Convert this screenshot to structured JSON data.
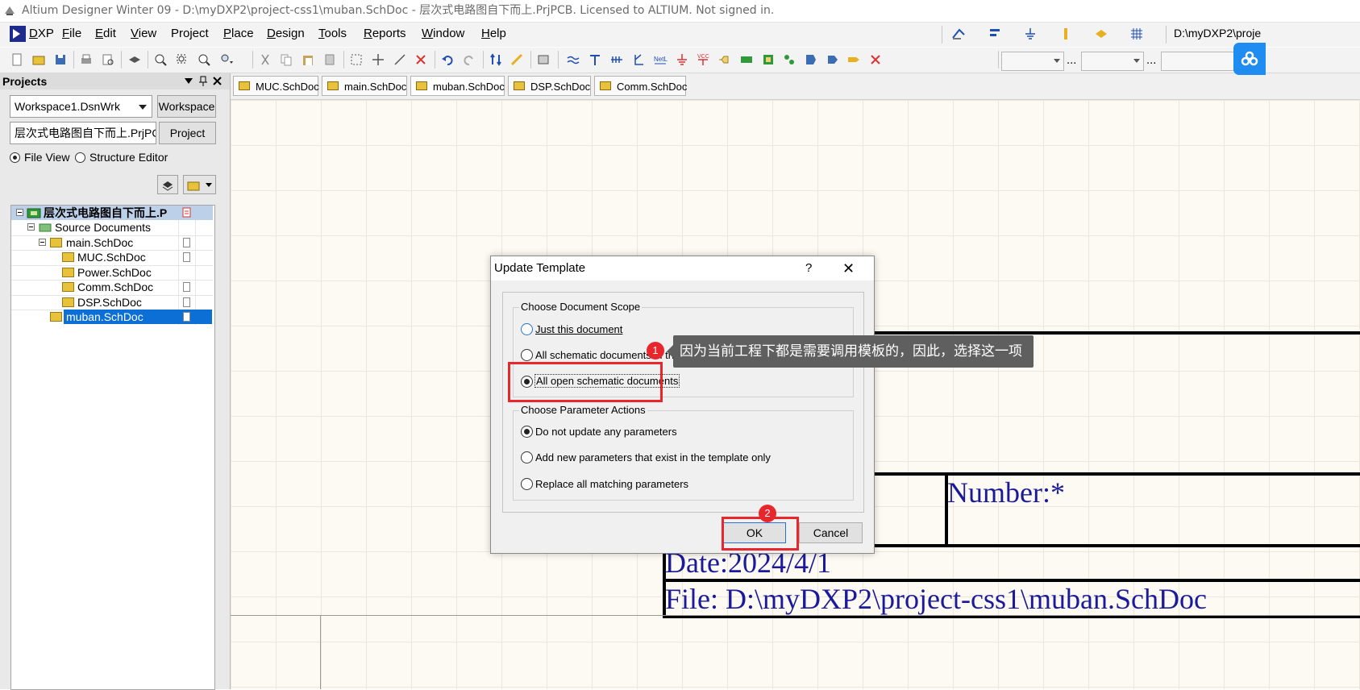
{
  "window": {
    "title": "Altium Designer Winter 09 - D:\\myDXP2\\project-css1\\muban.SchDoc - 层次式电路图自下而上.PrjPCB. Licensed to ALTIUM. Not signed in."
  },
  "menu": {
    "items": [
      {
        "first": "D",
        "rest": "XP"
      },
      {
        "first": "F",
        "rest": "ile"
      },
      {
        "first": "E",
        "rest": "dit"
      },
      {
        "first": "V",
        "rest": "iew"
      },
      {
        "first": "",
        "rest": "Project"
      },
      {
        "first": "P",
        "rest": "lace"
      },
      {
        "first": "D",
        "rest": "esign"
      },
      {
        "first": "T",
        "rest": "ools"
      },
      {
        "first": "R",
        "rest": "eports"
      },
      {
        "first": "W",
        "rest": "indow"
      },
      {
        "first": "H",
        "rest": "elp"
      }
    ],
    "path_text": "D:\\myDXP2\\proje"
  },
  "toolbar": {
    "combo_dots": "..."
  },
  "projects_panel": {
    "title": "Projects",
    "workspace_combo": "Workspace1.DsnWrk",
    "workspace_button": "Workspace",
    "project_combo": "层次式电路图自下而上.PrjPC",
    "project_button": "Project",
    "file_view_label": "File View",
    "structure_editor_label": "Structure Editor",
    "tree": {
      "root": "层次式电路图自下而上.P",
      "source_documents": "Source Documents",
      "main": "main.SchDoc",
      "muc": "MUC.SchDoc",
      "power": "Power.SchDoc",
      "comm": "Comm.SchDoc",
      "dsp": "DSP.SchDoc",
      "muban": "muban.SchDoc"
    }
  },
  "doc_tabs": [
    "MUC.SchDoc",
    "main.SchDoc",
    "muban.SchDoc",
    "DSP.SchDoc",
    "Comm.SchDoc"
  ],
  "sheet": {
    "number_label": "Number:*",
    "date_label": "Date:2024/4/1",
    "file_label": "File:  D:\\myDXP2\\project-css1\\muban.SchDoc"
  },
  "dialog": {
    "title": "Update Template",
    "help": "?",
    "close": "✕",
    "scope_group": "Choose Document Scope",
    "opt_just_this": "Just this document",
    "opt_all_schematic": "All schematic documents in the c",
    "opt_all_open": "All open schematic documents",
    "param_group": "Choose Parameter Actions",
    "opt_do_not_update": "Do not update any parameters",
    "opt_add_new": "Add new parameters that exist in the template only",
    "opt_replace": "Replace all matching parameters",
    "ok": "OK",
    "cancel": "Cancel"
  },
  "annotations": {
    "badge1": "1",
    "badge2": "2",
    "tooltip": "因为当前工程下都是需要调用模板的，因此，选择这一项"
  }
}
